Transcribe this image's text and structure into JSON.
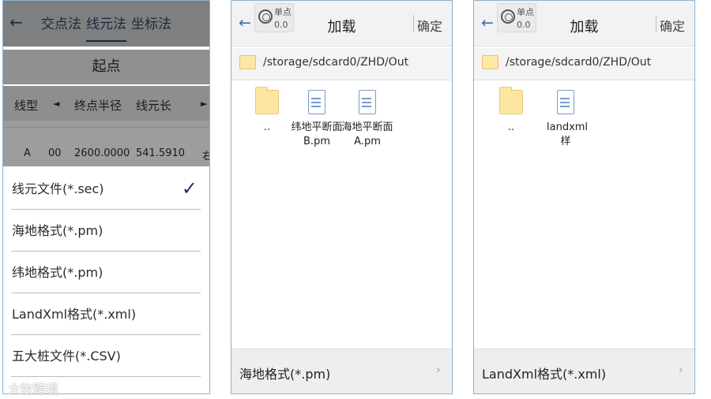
{
  "panel1": {
    "tabs": [
      "交点法",
      "线元法",
      "坐标法"
    ],
    "back_icon": "arrow-left-icon",
    "start_label": "起点",
    "table_headers": [
      "线型",
      "◄",
      "终点半径",
      "线元长",
      "►"
    ],
    "table_row": [
      "A",
      "00",
      "2600.0000",
      "541.5910",
      "右"
    ],
    "format_options": [
      {
        "label": "线元文件(*.sec)",
        "selected": true
      },
      {
        "label": "海地格式(*.pm)",
        "selected": false
      },
      {
        "label": "纬地格式(*.pm)",
        "selected": false
      },
      {
        "label": "LandXml格式(*.xml)",
        "selected": false
      },
      {
        "label": "五大桩文件(*.CSV)",
        "selected": false
      }
    ]
  },
  "panel2": {
    "unit_label": "单点",
    "unit_value": "0.0",
    "title": "加载",
    "ok_label": "确定",
    "path": "/storage/sdcard0/ZHD/Out",
    "files": [
      {
        "icon": "folder-icon",
        "name": ".."
      },
      {
        "icon": "document-icon",
        "name": "纬地平断面B.pm"
      },
      {
        "icon": "document-icon",
        "name": "海地平断面A.pm"
      }
    ],
    "format": "海地格式(*.pm)"
  },
  "panel3": {
    "unit_label": "单点",
    "unit_value": "0.0",
    "title": "加载",
    "ok_label": "确定",
    "path": "/storage/sdcard0/ZHD/Out",
    "files": [
      {
        "icon": "folder-icon",
        "name": ".."
      },
      {
        "icon": "document-icon",
        "name": "landxml样"
      }
    ],
    "format": "LandXml格式(*.xml)"
  },
  "watermark": "大牧跨境"
}
